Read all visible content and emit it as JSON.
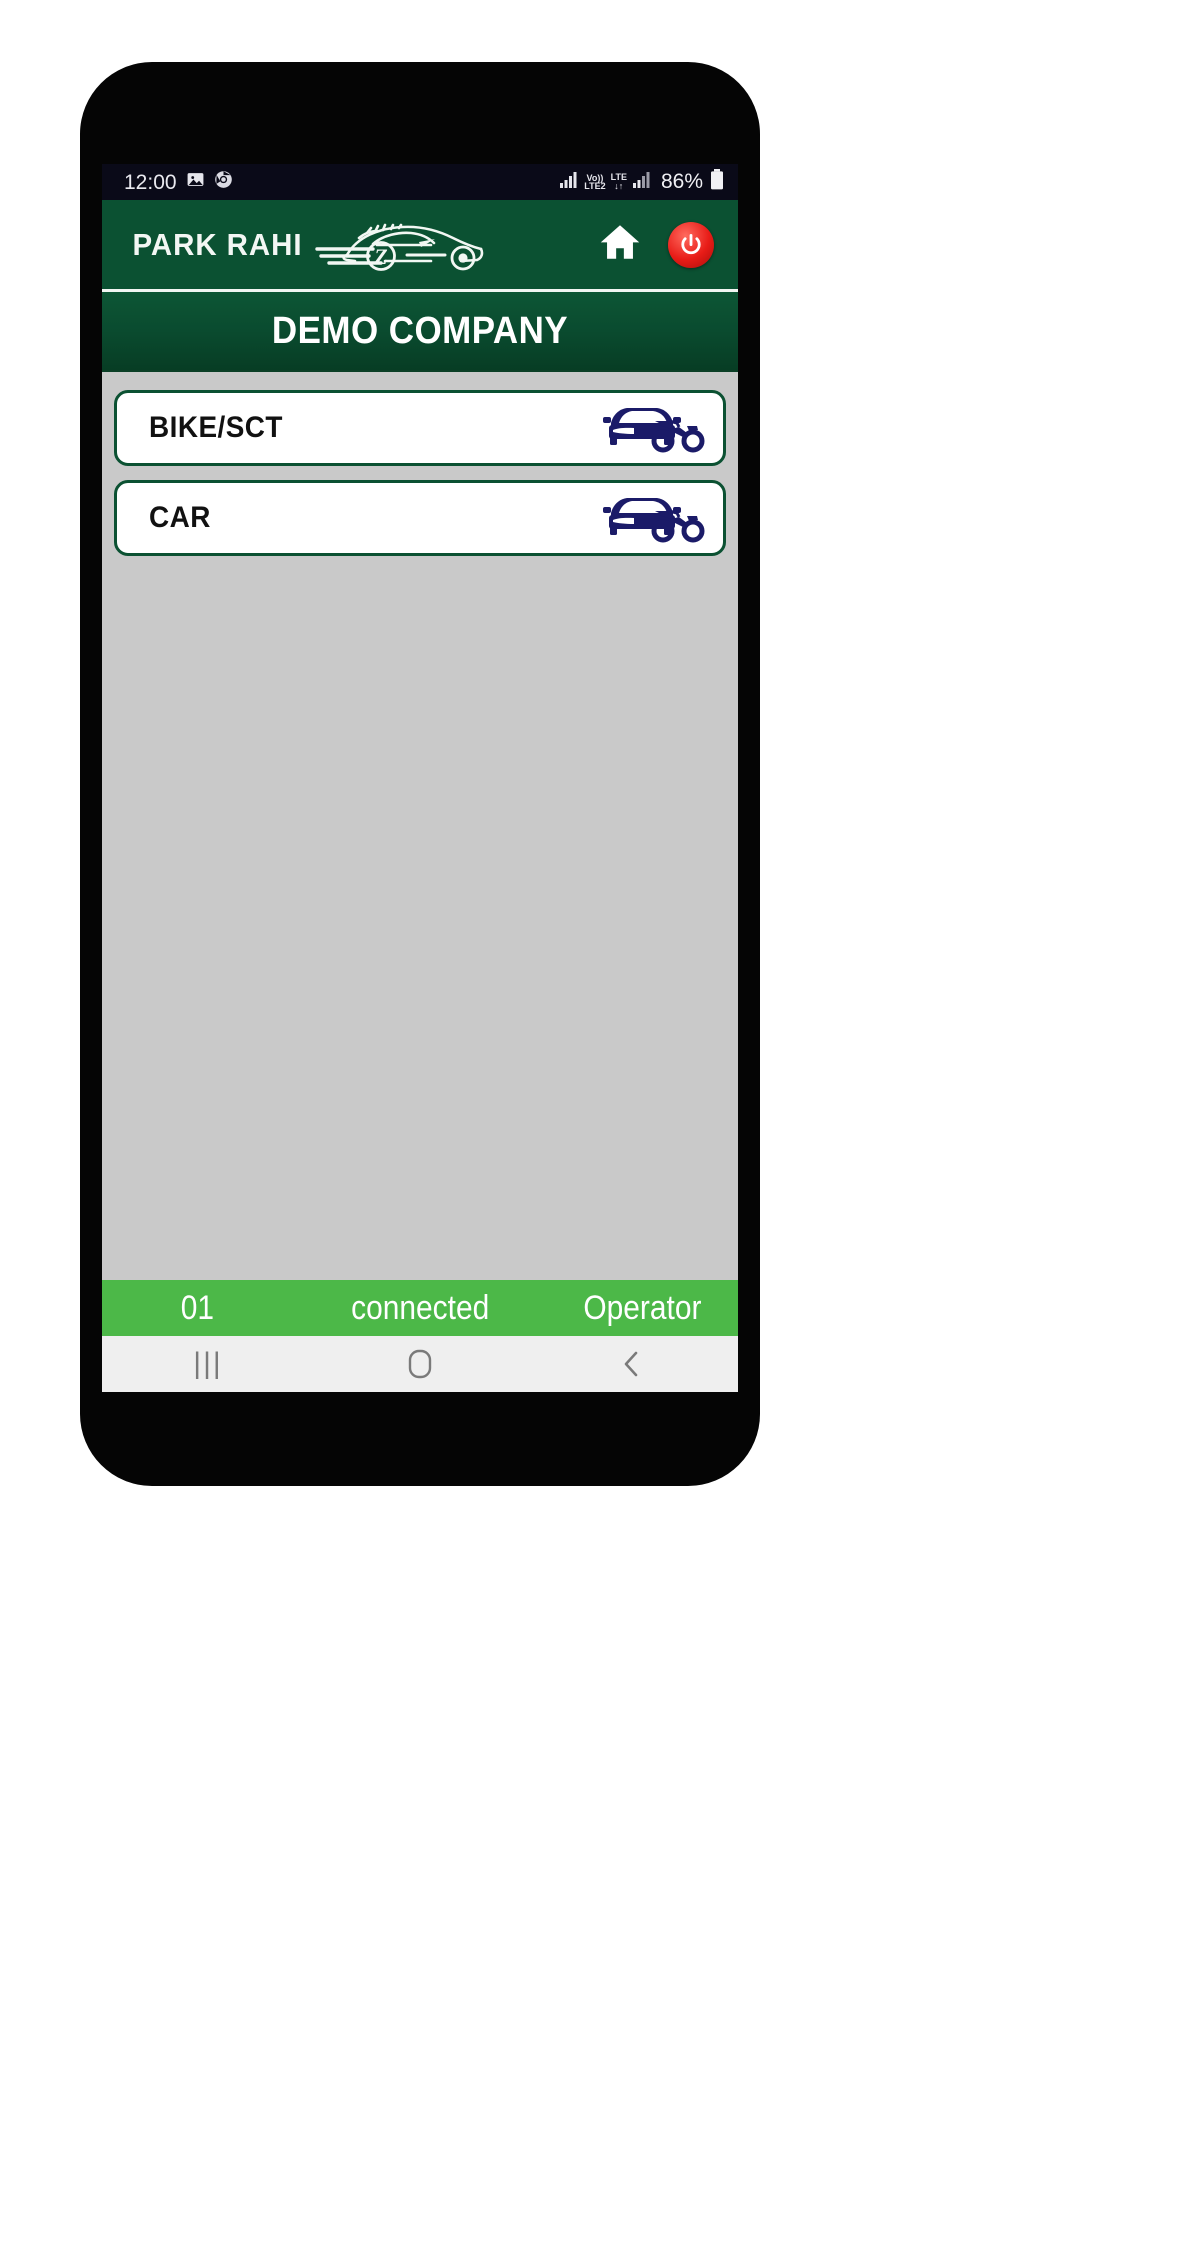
{
  "status_bar": {
    "time": "12:00",
    "icons_left": [
      "gallery-icon",
      "chrome-icon"
    ],
    "network": {
      "voice_label": "Vo))",
      "sim_label": "LTE2",
      "data_label": "LTE",
      "data_arrows": "↓↑"
    },
    "battery_percent": "86%",
    "battery_icon": "battery-full-icon"
  },
  "header": {
    "brand_name": "PARK RAHI",
    "brand_mark": "sports-car-logo",
    "logo_badge_letter": "Z",
    "home_icon": "home-icon",
    "power_icon": "power-icon",
    "accent_green": "#0b5132",
    "power_red": "#e81c17"
  },
  "banner": {
    "company_name": "DEMO COMPANY"
  },
  "content": {
    "vehicle_types": [
      {
        "label": "BIKE/SCT",
        "icon": "car-bike-icon"
      },
      {
        "label": "CAR",
        "icon": "car-bike-icon"
      }
    ],
    "background_color": "#c9c9c9",
    "icon_color": "#1b1b68"
  },
  "app_status": {
    "counter": "01",
    "connection": "connected",
    "role": "Operator",
    "bar_color": "#4cb848"
  },
  "nav_bar": {
    "recents_icon": "recents-icon",
    "home_icon": "home-square-icon",
    "back_icon": "back-chevron-icon"
  }
}
